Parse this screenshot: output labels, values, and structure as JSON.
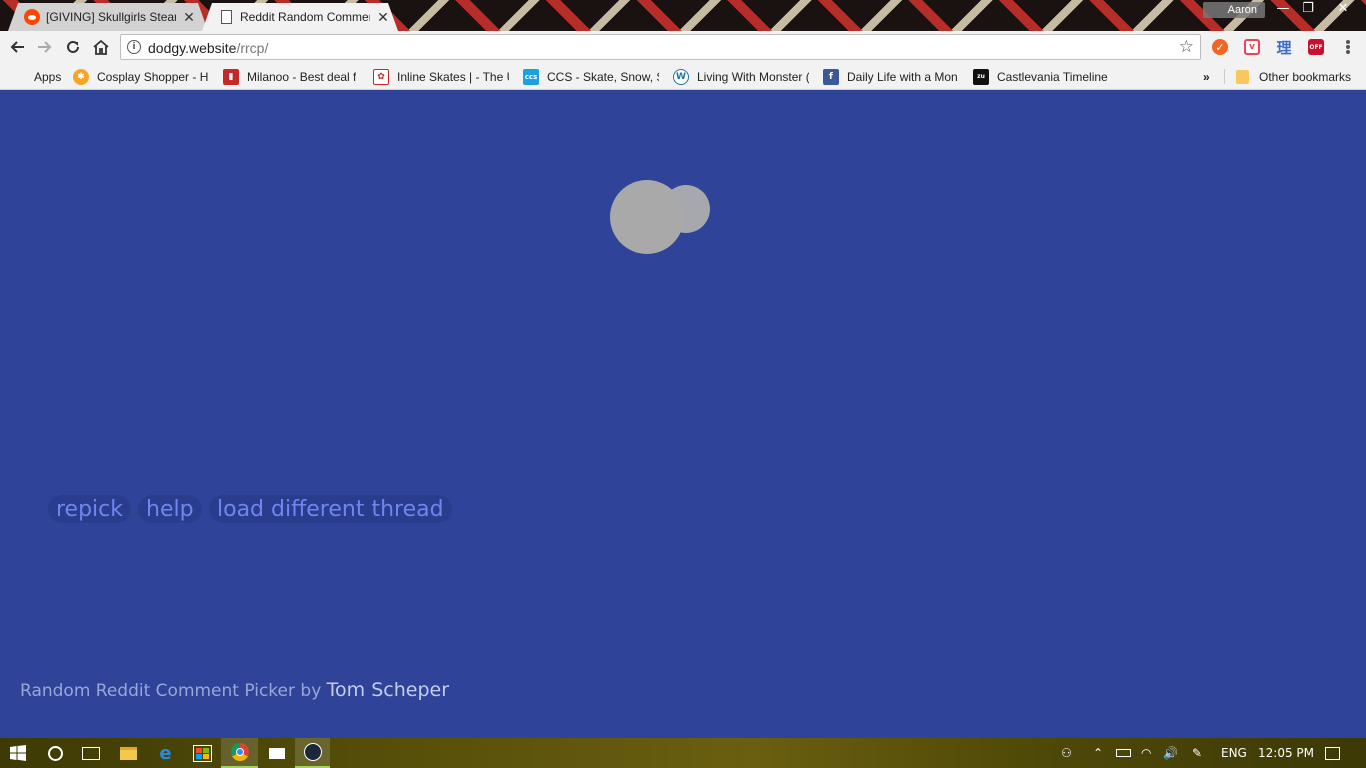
{
  "browser": {
    "tabs": [
      {
        "title": "[GIVING] Skullgirls Steam",
        "favicon": "reddit-icon",
        "active": false
      },
      {
        "title": "Reddit Random Commen",
        "favicon": "document-icon",
        "active": true
      }
    ],
    "profile_name": "Aaron",
    "window_controls": {
      "minimize": "—",
      "maximize": "❐",
      "close": "✕"
    },
    "url_host": "dodgy.website",
    "url_path": "/rrcp/",
    "bookmarks": [
      {
        "label": "Apps",
        "icon": "apps-grid-icon"
      },
      {
        "label": "Cosplay Shopper - H",
        "icon": "cosplay-shopper-icon"
      },
      {
        "label": "Milanoo - Best deal f",
        "icon": "milanoo-icon"
      },
      {
        "label": "Inline Skates | - The U",
        "icon": "inline-skates-icon"
      },
      {
        "label": "CCS - Skate, Snow, St",
        "icon": "ccs-icon"
      },
      {
        "label": "Living With Monster (",
        "icon": "wordpress-icon"
      },
      {
        "label": "Daily Life with a Mon",
        "icon": "facebook-icon"
      },
      {
        "label": "Castlevania Timeline",
        "icon": "castlevania-icon"
      }
    ],
    "bookmarks_overflow": "»",
    "other_bookmarks": "Other bookmarks",
    "extensions": [
      {
        "name": "extension-orange-icon",
        "color": "#f26522"
      },
      {
        "name": "pocket-icon",
        "color": "#ef4056"
      },
      {
        "name": "rikaikun-icon",
        "text": "理",
        "color": "#3b6bc5"
      },
      {
        "name": "adblock-off-icon",
        "color": "#c8102e"
      }
    ]
  },
  "page": {
    "background_color": "#2f4499",
    "buttons": {
      "repick": "repick",
      "help": "help",
      "load_different_thread": "load different thread"
    },
    "footer_prefix": "Random Reddit Comment Picker by",
    "footer_author": "Tom Scheper"
  },
  "taskbar": {
    "language": "ENG",
    "time": "12:05 PM"
  }
}
